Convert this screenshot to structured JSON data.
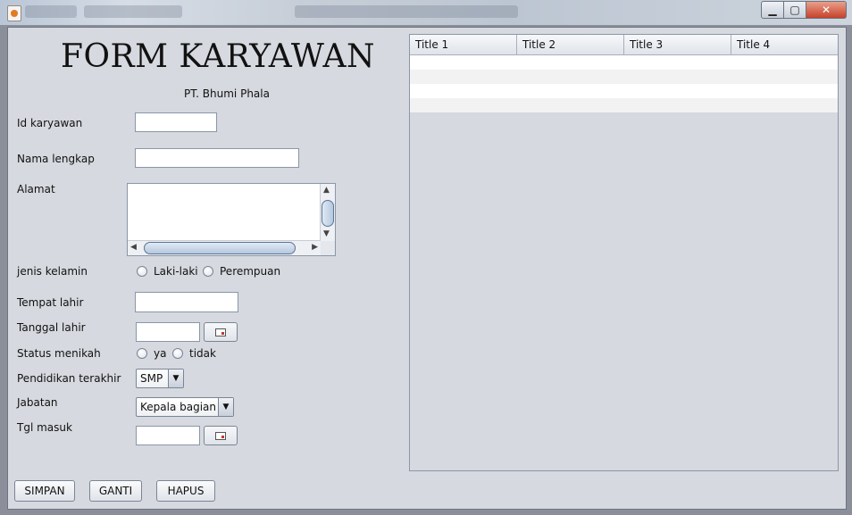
{
  "window": {
    "controls": {
      "minimize": "▁",
      "maximize": "▢",
      "close": "✕"
    }
  },
  "form": {
    "title": "FORM KARYAWAN",
    "subtitle": "PT. Bhumi Phala",
    "fields": {
      "id_karyawan": {
        "label": "Id karyawan",
        "value": ""
      },
      "nama_lengkap": {
        "label": "Nama lengkap",
        "value": ""
      },
      "alamat": {
        "label": "Alamat",
        "value": ""
      },
      "jenis_kelamin": {
        "label": "jenis kelamin",
        "options": [
          "Laki-laki",
          "Perempuan"
        ]
      },
      "tempat_lahir": {
        "label": "Tempat lahir",
        "value": ""
      },
      "tanggal_lahir": {
        "label": "Tanggal lahir",
        "value": ""
      },
      "status_menikah": {
        "label": "Status menikah",
        "options": [
          "ya",
          "tidak"
        ]
      },
      "pendidikan_terakhir": {
        "label": "Pendidikan terakhir",
        "selected": "SMP"
      },
      "jabatan": {
        "label": "Jabatan",
        "selected": "Kepala bagian"
      },
      "tgl_masuk": {
        "label": "Tgl masuk",
        "value": ""
      }
    },
    "buttons": {
      "simpan": "SIMPAN",
      "ganti": "GANTI",
      "hapus": "HAPUS"
    }
  },
  "table": {
    "columns": [
      "Title 1",
      "Title 2",
      "Title 3",
      "Title 4"
    ],
    "rows": [
      [
        "",
        "",
        "",
        ""
      ],
      [
        "",
        "",
        "",
        ""
      ],
      [
        "",
        "",
        "",
        ""
      ],
      [
        "",
        "",
        "",
        ""
      ]
    ]
  },
  "icons": {
    "scroll_up": "▲",
    "scroll_down": "▼",
    "scroll_left": "◀",
    "scroll_right": "▶",
    "dropdown": "▼"
  }
}
